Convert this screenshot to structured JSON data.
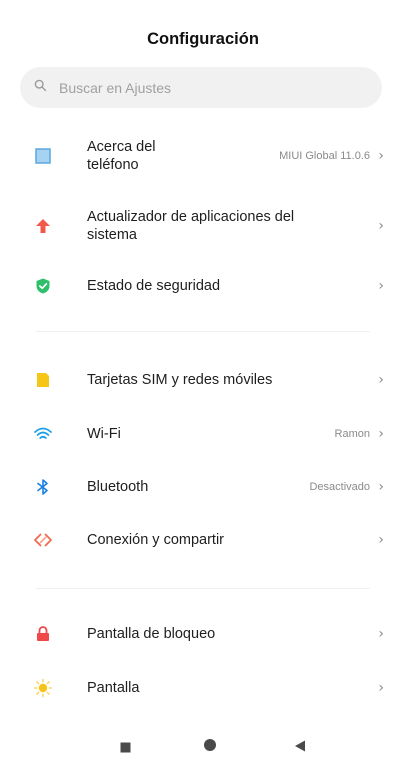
{
  "header": {
    "title": "Configuración"
  },
  "search": {
    "placeholder": "Buscar en Ajustes"
  },
  "items": [
    {
      "label": "Acerca del\nteléfono",
      "value": "MIUI Global 11.0.6",
      "icon": "phone-icon",
      "color": "#5ba8e0"
    },
    {
      "label": "Actualizador de aplicaciones del\nsistema",
      "value": "",
      "icon": "update-arrow-icon",
      "color": "#f15a4a"
    },
    {
      "label": "Estado de seguridad",
      "value": "",
      "icon": "shield-check-icon",
      "color": "#2fbf6b"
    },
    {
      "label": "Tarjetas SIM y redes móviles",
      "value": "",
      "icon": "sim-card-icon",
      "color": "#f5c518"
    },
    {
      "label": "Wi-Fi",
      "value": "Ramon",
      "icon": "wifi-icon",
      "color": "#1ea0e8"
    },
    {
      "label": "Bluetooth",
      "value": "Desactivado",
      "icon": "bluetooth-icon",
      "color": "#1a7fe0"
    },
    {
      "label": "Conexión y compartir",
      "value": "",
      "icon": "connection-share-icon",
      "color": "#f26a4b"
    },
    {
      "label": "Pantalla de bloqueo",
      "value": "",
      "icon": "lock-icon",
      "color": "#f04848"
    },
    {
      "label": "Pantalla",
      "value": "",
      "icon": "sun-icon",
      "color": "#f7c31a"
    }
  ],
  "chevron": "›",
  "navbar": {
    "icons": [
      "recent-apps-icon",
      "home-icon",
      "back-icon"
    ]
  }
}
